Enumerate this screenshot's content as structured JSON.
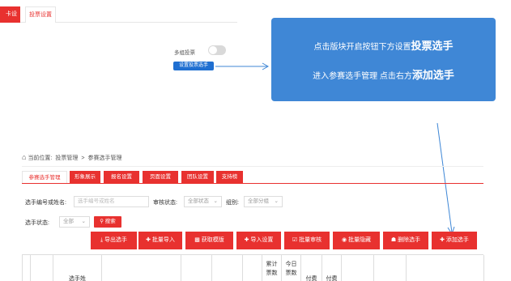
{
  "top_tabs": [
    "卡设置",
    "投票设置"
  ],
  "vote_setting": {
    "multi_group_label": "多组投票",
    "setup_button": "设置投票选手"
  },
  "callout": {
    "line1_prefix": "点击版块开启按钮下方设置",
    "line1_big": "投票选手",
    "line2_prefix": "进入参赛选手管理 点击右方",
    "line2_big": "添加选手"
  },
  "breadcrumb": {
    "home_icon": "home-icon",
    "label": "当前位置:",
    "items": [
      "投票管理",
      "参赛选手管理"
    ],
    "separator": ">"
  },
  "sub_tabs": [
    "参赛选手管理",
    "形象展示",
    "报名设置",
    "页面设置",
    "团队设置",
    "支持榜"
  ],
  "filters": {
    "id_label": "选手编号或姓名:",
    "id_placeholder": "选手编号或姓名",
    "audit_label": "审核状态:",
    "audit_value": "全部状态",
    "group_label": "组别:",
    "group_value": "全部分组",
    "status_label": "选手状态:",
    "status_value": "全部",
    "search_button": "搜索"
  },
  "actions": [
    "导出选手",
    "批量导入",
    "获取模版",
    "导入设置",
    "批量审核",
    "批量隐藏",
    "删除选手",
    "添加选手"
  ],
  "table_header": {
    "col_name_partial": "选手姓",
    "col_total_1": "累计",
    "col_total_2": "票数",
    "col_today_1": "今日",
    "col_today_2": "票数",
    "col_pay": "付费",
    "col_pay2": "付费"
  },
  "colors": {
    "brand_red": "#e8312f",
    "callout_blue": "#3f87d6",
    "button_blue": "#1f6fd1"
  }
}
